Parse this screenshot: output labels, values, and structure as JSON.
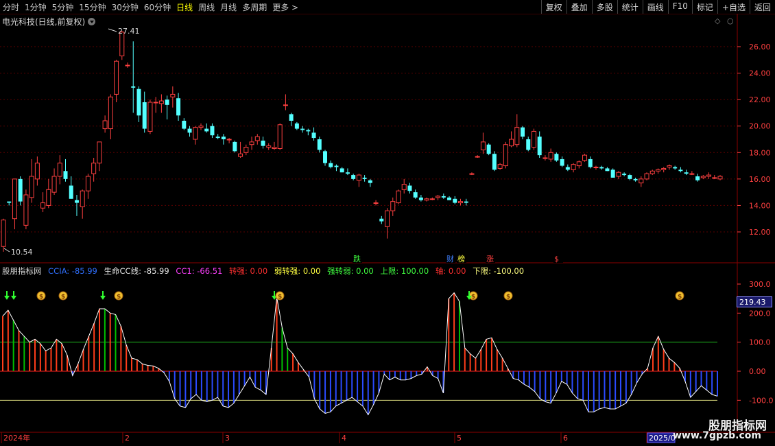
{
  "periods": [
    "分时",
    "1分钟",
    "5分钟",
    "15分钟",
    "30分钟",
    "60分钟",
    "日线",
    "周线",
    "月线",
    "多周期",
    "更多 >"
  ],
  "active_period": "日线",
  "toolbar": [
    "复权",
    "叠加",
    "多股",
    "统计",
    "画线",
    "F10",
    "标记",
    "+自选",
    "返回"
  ],
  "stock_title": "电光科技(日线,前复权)",
  "price_axis": [
    "26.00",
    "24.00",
    "22.00",
    "20.00",
    "18.00",
    "16.00",
    "14.00",
    "12.00"
  ],
  "high_label": "27.41",
  "low_label": "10.54",
  "event_tags": [
    "跌",
    "财",
    "榜",
    "涨",
    "$"
  ],
  "indicator": {
    "name": "股朋指标网",
    "ccia": "CCIA: -85.99",
    "life": "生命CC线: -85.99",
    "cc1": "CC1: -66.51",
    "zq": "转强: 0.00",
    "rzq": "弱转强: 0.00",
    "qzr": "强转弱: 0.00",
    "upper": "上限: 100.00",
    "axis": "轴: 0.00",
    "lower": "下限: -100.00"
  },
  "ind_axis": [
    "300.0",
    "200.0",
    "100.0",
    "0.00",
    "-100.0"
  ],
  "current_value": "219.43",
  "time_labels": [
    "2024年",
    "2",
    "3",
    "4",
    "5",
    "6",
    "2025/0"
  ],
  "watermark": {
    "name": "股朋指标网",
    "url": "www.7gpzb.com"
  },
  "colors": {
    "up": "#ff4040",
    "down": "#54ffff",
    "ind_pos": "#ff3d1a",
    "ind_neg": "#2b4bff",
    "green": "#00c000",
    "grid": "#5a0000"
  },
  "chart_data": [
    {
      "type": "candlestick",
      "title": "电光科技(日线,前复权)",
      "ylim": [
        10.5,
        28
      ],
      "ohlc": [
        [
          10.9,
          13.0,
          10.5,
          12.9
        ],
        [
          14.3,
          14.3,
          14.0,
          14.2
        ],
        [
          13.0,
          16.0,
          12.2,
          16.0
        ],
        [
          16.0,
          16.2,
          14.0,
          14.3
        ],
        [
          12.5,
          15.2,
          12.2,
          14.8
        ],
        [
          14.6,
          17.5,
          14.2,
          16.2
        ],
        [
          16.0,
          17.7,
          15.5,
          17.2
        ],
        [
          13.8,
          15.0,
          13.5,
          14.2
        ],
        [
          14.0,
          16.0,
          13.8,
          15.2
        ],
        [
          15.0,
          16.8,
          14.8,
          16.2
        ],
        [
          16.2,
          17.8,
          15.6,
          17.2
        ],
        [
          16.6,
          17.5,
          15.8,
          16.0
        ],
        [
          15.5,
          16.2,
          14.5,
          14.5
        ],
        [
          14.4,
          14.8,
          13.2,
          14.2
        ],
        [
          13.9,
          15.2,
          13.0,
          15.1
        ],
        [
          15.1,
          16.4,
          14.5,
          16.2
        ],
        [
          16.4,
          17.6,
          15.8,
          17.2
        ],
        [
          17.2,
          18.8,
          16.6,
          18.8
        ],
        [
          19.8,
          20.8,
          19.5,
          20.4
        ],
        [
          19.8,
          22.4,
          19.0,
          22.2
        ],
        [
          22.4,
          25.0,
          21.8,
          24.9
        ],
        [
          25.3,
          27.2,
          25.0,
          27.1
        ],
        [
          24.6,
          24.8,
          24.4,
          24.6
        ],
        [
          23.0,
          26.4,
          21.0,
          22.9
        ],
        [
          22.8,
          23.0,
          20.3,
          20.8
        ],
        [
          21.8,
          22.6,
          19.5,
          19.8
        ],
        [
          19.6,
          22.0,
          19.4,
          21.8
        ],
        [
          21.8,
          22.2,
          21.0,
          21.8
        ],
        [
          21.7,
          22.4,
          21.0,
          21.9
        ],
        [
          22.0,
          22.3,
          20.5,
          21.6
        ],
        [
          22.2,
          23.0,
          21.4,
          22.4
        ],
        [
          22.1,
          22.5,
          20.4,
          20.8
        ],
        [
          20.4,
          20.6,
          19.7,
          19.8
        ],
        [
          19.8,
          20.0,
          19.2,
          19.5
        ],
        [
          19.0,
          20.0,
          18.6,
          19.9
        ],
        [
          19.9,
          20.2,
          19.7,
          20.0
        ],
        [
          19.8,
          20.2,
          19.5,
          19.6
        ],
        [
          20.0,
          20.2,
          19.1,
          19.3
        ],
        [
          19.2,
          19.4,
          19.0,
          19.1
        ],
        [
          19.2,
          19.4,
          18.6,
          19.0
        ],
        [
          19.0,
          19.1,
          18.7,
          19.0
        ],
        [
          18.8,
          18.9,
          18.0,
          18.1
        ],
        [
          17.7,
          18.8,
          17.6,
          17.9
        ],
        [
          18.0,
          18.6,
          17.8,
          18.4
        ],
        [
          18.6,
          19.2,
          18.2,
          18.8
        ],
        [
          18.9,
          19.4,
          18.6,
          19.2
        ],
        [
          18.9,
          19.2,
          18.3,
          18.5
        ],
        [
          18.4,
          18.7,
          18.2,
          18.5
        ],
        [
          18.3,
          18.8,
          18.2,
          18.4
        ],
        [
          18.3,
          20.2,
          18.2,
          20.1
        ],
        [
          21.6,
          22.4,
          21.2,
          21.6
        ],
        [
          20.9,
          21.0,
          20.0,
          20.4
        ],
        [
          20.2,
          20.3,
          19.7,
          19.8
        ],
        [
          19.8,
          20.0,
          19.5,
          19.7
        ],
        [
          19.7,
          19.8,
          19.3,
          19.6
        ],
        [
          19.5,
          19.9,
          18.9,
          19.1
        ],
        [
          19.0,
          19.2,
          18.0,
          18.2
        ],
        [
          18.1,
          18.2,
          17.0,
          17.2
        ],
        [
          17.2,
          17.4,
          16.8,
          16.9
        ],
        [
          17.0,
          17.1,
          16.6,
          16.9
        ],
        [
          16.8,
          16.9,
          16.5,
          16.5
        ],
        [
          16.5,
          16.8,
          16.3,
          16.4
        ],
        [
          16.3,
          16.4,
          15.9,
          16.0
        ],
        [
          15.9,
          16.4,
          15.4,
          16.3
        ],
        [
          16.1,
          16.3,
          15.8,
          16.0
        ],
        [
          15.9,
          16.0,
          15.4,
          15.7
        ],
        [
          14.2,
          14.4,
          14.0,
          14.2
        ],
        [
          13.0,
          13.2,
          12.6,
          12.8
        ],
        [
          12.4,
          13.8,
          11.5,
          13.6
        ],
        [
          13.6,
          14.6,
          13.2,
          14.3
        ],
        [
          14.2,
          15.2,
          14.1,
          15.1
        ],
        [
          15.2,
          16.0,
          14.9,
          15.6
        ],
        [
          15.5,
          15.7,
          14.9,
          15.1
        ],
        [
          15.0,
          15.2,
          14.5,
          14.6
        ],
        [
          14.6,
          14.8,
          14.3,
          14.4
        ],
        [
          14.4,
          14.6,
          14.3,
          14.5
        ],
        [
          14.5,
          14.6,
          14.4,
          14.5
        ],
        [
          14.6,
          14.8,
          14.4,
          14.7
        ],
        [
          14.7,
          14.9,
          14.5,
          14.6
        ],
        [
          14.6,
          14.7,
          14.4,
          14.4
        ],
        [
          14.5,
          14.7,
          14.1,
          14.2
        ],
        [
          14.2,
          14.5,
          14.0,
          14.3
        ],
        [
          14.3,
          14.5,
          14.0,
          14.2
        ],
        [
          16.4,
          16.5,
          16.3,
          16.4
        ],
        [
          17.7,
          17.8,
          17.6,
          17.7
        ],
        [
          18.2,
          19.5,
          17.9,
          18.8
        ],
        [
          18.6,
          18.7,
          17.8,
          17.9
        ],
        [
          17.9,
          18.1,
          16.6,
          16.7
        ],
        [
          16.8,
          17.2,
          16.7,
          17.1
        ],
        [
          17.0,
          18.8,
          16.8,
          18.6
        ],
        [
          18.5,
          19.6,
          18.4,
          19.0
        ],
        [
          18.6,
          20.9,
          18.4,
          19.9
        ],
        [
          19.9,
          20.0,
          19.0,
          19.2
        ],
        [
          19.0,
          19.2,
          18.1,
          18.2
        ],
        [
          18.4,
          19.8,
          18.2,
          19.6
        ],
        [
          19.2,
          19.6,
          17.6,
          17.8
        ],
        [
          17.6,
          17.8,
          17.4,
          17.6
        ],
        [
          17.5,
          18.3,
          17.3,
          18.0
        ],
        [
          17.9,
          18.0,
          17.3,
          17.4
        ],
        [
          17.5,
          17.7,
          16.9,
          17.0
        ],
        [
          16.9,
          17.1,
          16.6,
          16.7
        ],
        [
          16.7,
          17.2,
          16.5,
          17.1
        ],
        [
          17.0,
          17.4,
          16.8,
          17.3
        ],
        [
          17.4,
          17.9,
          17.3,
          17.8
        ],
        [
          17.5,
          17.7,
          16.8,
          16.9
        ],
        [
          16.9,
          17.0,
          16.7,
          16.9
        ],
        [
          16.9,
          17.0,
          16.7,
          16.8
        ],
        [
          16.8,
          16.9,
          16.6,
          16.6
        ],
        [
          16.7,
          16.8,
          16.1,
          16.1
        ],
        [
          16.2,
          16.6,
          16.0,
          16.5
        ],
        [
          16.4,
          16.5,
          16.2,
          16.3
        ],
        [
          16.3,
          16.4,
          15.9,
          16.0
        ],
        [
          16.0,
          16.1,
          15.8,
          15.9
        ],
        [
          15.7,
          16.2,
          15.4,
          16.0
        ],
        [
          16.0,
          16.5,
          15.9,
          16.4
        ],
        [
          16.4,
          16.7,
          16.3,
          16.6
        ],
        [
          16.6,
          16.8,
          16.4,
          16.7
        ],
        [
          16.7,
          16.9,
          16.5,
          16.8
        ],
        [
          16.9,
          17.1,
          16.7,
          17.0
        ],
        [
          16.9,
          17.0,
          16.7,
          16.8
        ],
        [
          16.7,
          16.9,
          16.5,
          16.6
        ],
        [
          16.5,
          16.7,
          16.3,
          16.4
        ],
        [
          16.4,
          16.6,
          16.3,
          16.4
        ],
        [
          16.2,
          16.4,
          15.8,
          15.9
        ],
        [
          16.1,
          16.3,
          16.0,
          16.2
        ],
        [
          16.2,
          16.5,
          16.0,
          16.3
        ],
        [
          16.1,
          16.3,
          16.0,
          16.1
        ],
        [
          16.0,
          16.3,
          15.9,
          16.2
        ]
      ]
    },
    {
      "type": "bar",
      "title": "股朋指标网",
      "ylim": [
        -150,
        330
      ],
      "series": [
        {
          "name": "CCIA",
          "values": [
            190,
            210,
            175,
            140,
            120,
            100,
            110,
            95,
            70,
            80,
            110,
            95,
            55,
            -15,
            25,
            75,
            120,
            165,
            215,
            215,
            200,
            195,
            155,
            90,
            45,
            40,
            25,
            20,
            18,
            10,
            -5,
            -35,
            -95,
            -120,
            -125,
            -95,
            -80,
            -100,
            -105,
            -100,
            -90,
            -120,
            -125,
            -110,
            -80,
            -50,
            -20,
            -55,
            -65,
            -80,
            80,
            255,
            150,
            80,
            60,
            30,
            5,
            -20,
            -95,
            -130,
            -145,
            -140,
            -120,
            -110,
            -100,
            -90,
            -105,
            -120,
            -150,
            -115,
            -75,
            -10,
            -30,
            -20,
            -30,
            -30,
            -25,
            -15,
            -10,
            15,
            -15,
            -25,
            -75,
            250,
            270,
            240,
            80,
            60,
            45,
            75,
            110,
            115,
            75,
            45,
            10,
            -25,
            -30,
            -45,
            -55,
            -70,
            -95,
            -105,
            -110,
            -75,
            -35,
            -45,
            -75,
            -95,
            -100,
            -140,
            -140,
            -130,
            -125,
            -130,
            -130,
            -120,
            -110,
            -80,
            -40,
            -10,
            10,
            80,
            120,
            75,
            45,
            30,
            10,
            -35,
            -90,
            -70,
            -50,
            -65,
            -80,
            -85.99
          ]
        }
      ]
    }
  ]
}
